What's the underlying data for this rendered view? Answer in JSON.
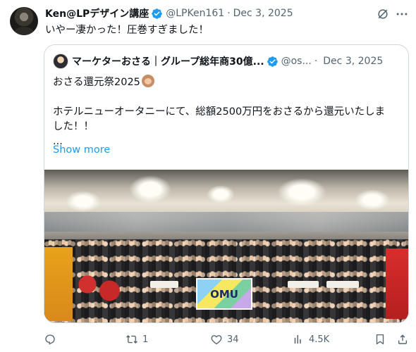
{
  "tweet": {
    "author_name": "Ken@LPデザイン講座",
    "handle": "@LPKen161",
    "separator": "·",
    "date": "Dec 3, 2025",
    "text": "いやー凄かった！圧巻すぎました！"
  },
  "quote": {
    "author_name": "マーケターおさる｜グループ総年商30億...",
    "handle": "@os...",
    "separator": "·",
    "date": "Dec 3, 2025",
    "line1": "おさる還元祭2025",
    "line2": "ホテルニューオータニーにて、総額2500万円をおさるから還元いたしま",
    "line3": "した！！",
    "line4": "...",
    "show_more": "Show more",
    "photo": {
      "banner_text": "OMU"
    }
  },
  "actions": {
    "replies": "",
    "retweets": "1",
    "likes": "34",
    "views": "4.5K"
  },
  "colors": {
    "link": "#1d9bf0",
    "verified": "#1d9bf0",
    "secondary_text": "#536471"
  },
  "icons": [
    "verified-badge-icon",
    "grok-icon",
    "more-icon",
    "reply-icon",
    "retweet-icon",
    "like-icon",
    "views-icon",
    "bookmark-icon",
    "share-icon"
  ]
}
